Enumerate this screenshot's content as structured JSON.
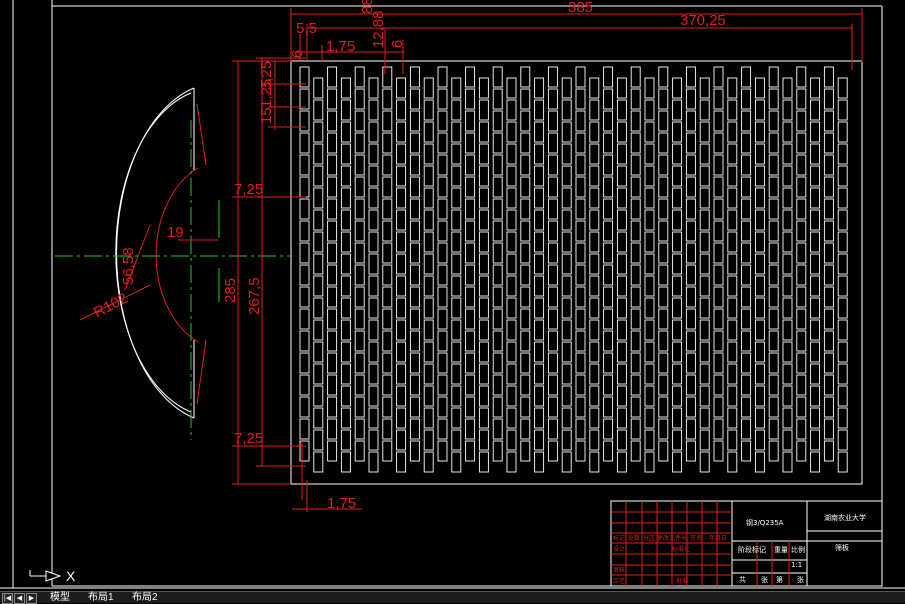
{
  "colors": {
    "background": "#000000",
    "drawing_lines": "#ffffff",
    "dimension": "#e21d1d",
    "centerline": "#22c422"
  },
  "dimensions": {
    "overall_width": "385",
    "inner_width": "370,25",
    "d_88": "88",
    "d_12_88": "12,88",
    "d_6": "6",
    "d_5_5": "5,5",
    "d_6b": "6",
    "d_1_75_top": "1,75",
    "d_3_25": "3,25",
    "d_1_25": "1,25",
    "d_15": "15",
    "d_7_25_upper": "7,25",
    "d_7_25_lower": "7,25",
    "d_285": "285",
    "d_267_5": "267,5",
    "d_1_75_bottom": "1,75",
    "d_19": "19",
    "d_56_58": "56,58",
    "d_r102": "R102"
  },
  "title_block": {
    "material": "钢3/Q235A",
    "school": "湖南农业大学",
    "part_name": "筛板",
    "row_labels": [
      "标记",
      "设计",
      "审核",
      "工艺"
    ],
    "header_cells": [
      "处数",
      "分区",
      "更改文件号",
      "签名",
      "年月日"
    ],
    "std_label": "标准化",
    "approve_label": "批准",
    "stage_labels": [
      "阶段标记",
      "重量",
      "比例"
    ],
    "scale": "1:1",
    "sheet_labels": [
      "共",
      "张",
      "第",
      "张"
    ]
  },
  "ucs": {
    "label": "X"
  },
  "tabs": {
    "model": "模型",
    "layout1": "布局1",
    "layout2": "布局2"
  }
}
